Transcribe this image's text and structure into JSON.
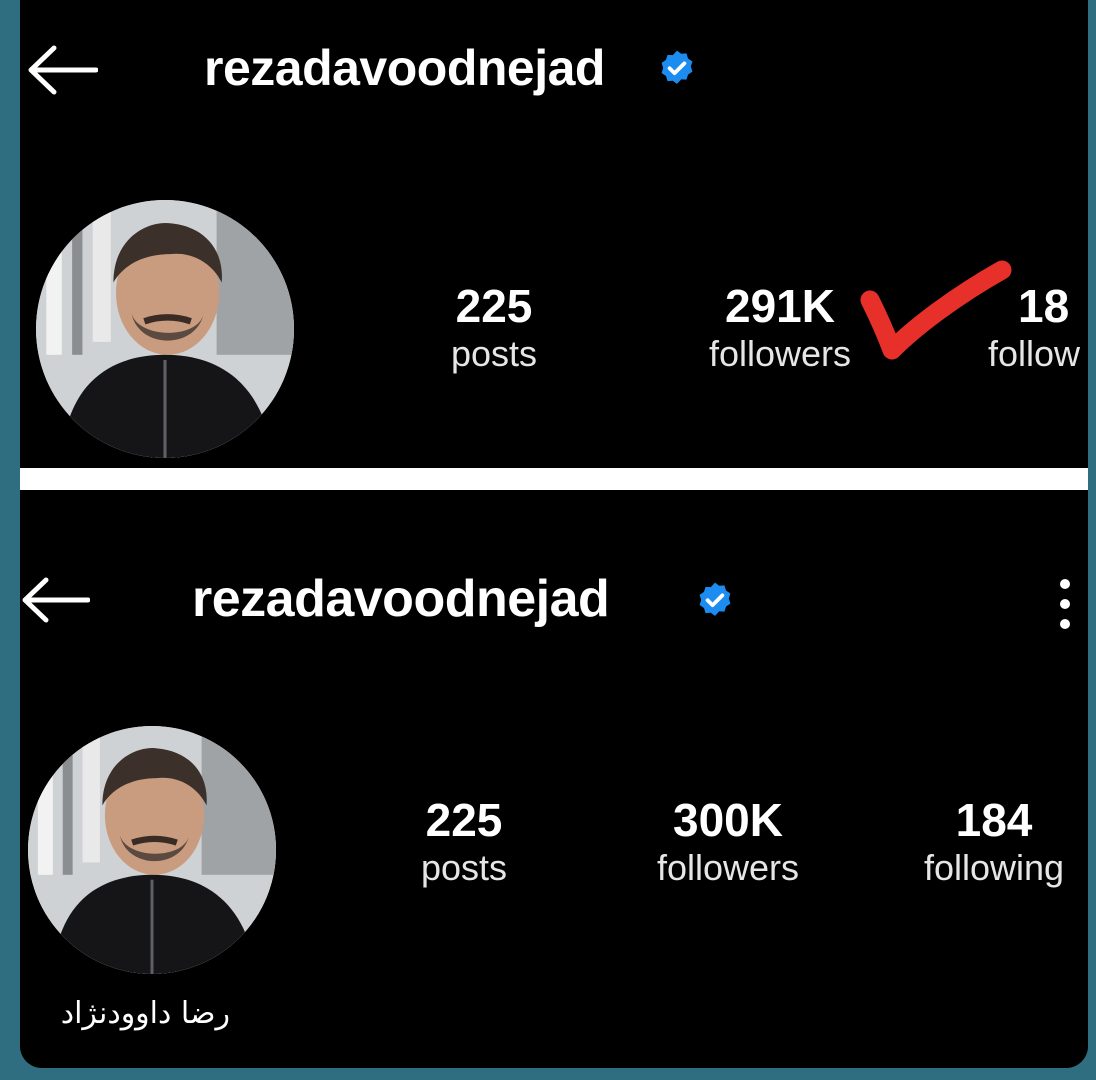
{
  "screenshots": [
    {
      "username": "rezadavoodnejad",
      "stats": [
        {
          "value": "225",
          "label": "posts"
        },
        {
          "value": "291K",
          "label": "followers"
        },
        {
          "value": "18",
          "label": "follow"
        }
      ]
    },
    {
      "username": "rezadavoodnejad",
      "full_name": "رضا داوودنژاد",
      "stats": [
        {
          "value": "225",
          "label": "posts"
        },
        {
          "value": "300K",
          "label": "followers"
        },
        {
          "value": "184",
          "label": "following"
        }
      ]
    }
  ],
  "icons": {
    "back": "arrow-left-icon",
    "verified": "verified-badge-icon",
    "menu": "more-vertical-icon",
    "annotation": "red-checkmark"
  },
  "colors": {
    "background": "#000000",
    "frame": "#2f6e80",
    "verified": "#1d8cf0",
    "annotation": "#e8302b"
  }
}
